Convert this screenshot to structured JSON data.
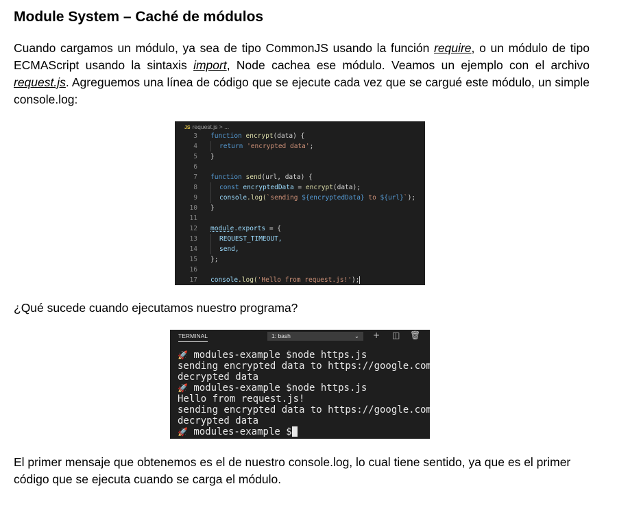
{
  "heading": "Module System – Caché de módulos",
  "intro": {
    "t1": "Cuando cargamos un módulo, ya sea de tipo CommonJS usando la función ",
    "link1": "require",
    "t2": ", o un módulo de tipo ECMAScript usando la sintaxis ",
    "link2": "import",
    "t3": ", Node cachea ese módulo. Veamos un ejemplo con el archivo ",
    "link3": "request.js",
    "t4": ". Agreguemos una línea de código que se ejecute cada vez que se cargué este módulo, un simple console.log:"
  },
  "code": {
    "breadcrumb_icon": "JS",
    "breadcrumb": "request.js > ...",
    "line_numbers": [
      "3",
      "4",
      "5",
      "6",
      "7",
      "8",
      "9",
      "10",
      "11",
      "12",
      "13",
      "14",
      "15",
      "16",
      "17"
    ],
    "tokens": {
      "function_kw": "function",
      "encrypt_fn": "encrypt",
      "data_param": "(data) {",
      "return_kw": "return",
      "encrypted_str": "'encrypted data'",
      "semi": ";",
      "close_brace": "}",
      "send_fn": "send",
      "send_params": "(url, data) {",
      "const_kw": "const",
      "encrypted_var": "encryptedData",
      "assign": " = ",
      "encrypt_call": "encrypt",
      "data_arg": "(data);",
      "console_obj": "console",
      "log_call": ".log(",
      "template_start": "`sending ",
      "template_var1": "${encryptedData}",
      "template_mid": " to ",
      "template_var2": "${url}",
      "template_end": "`",
      "close_call": ");",
      "module_obj": "module",
      "exports_prop": ".exports",
      "open_obj": " = {",
      "request_timeout": "REQUEST_TIMEOUT,",
      "send_prop": "send,",
      "close_obj": "};",
      "hello_str": "'Hello from request.js!'",
      "close_call2": ");"
    }
  },
  "question": "¿Qué sucede cuando ejecutamos nuestro programa?",
  "terminal": {
    "tab": "TERMINAL",
    "shell": "1: bash",
    "lines": [
      " modules-example $node https.js",
      "sending encrypted data to https://google.com",
      "decrypted data",
      " modules-example $node https.js",
      "Hello from request.js!",
      "sending encrypted data to https://google.com",
      "decrypted data",
      " modules-example $"
    ]
  },
  "conclusion": "El primer mensaje que obtenemos es el de nuestro console.log, lo cual tiene sentido, ya que es el primer código que se ejecuta cuando se carga el módulo."
}
